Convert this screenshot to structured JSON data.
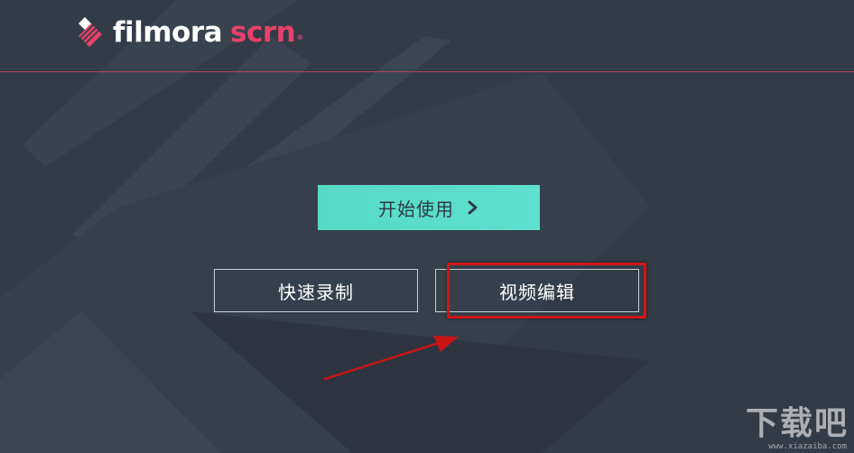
{
  "app": {
    "logo_word1": "filmora",
    "logo_word2": "scrn",
    "logo_reg": "®",
    "brand_color": "#e8426a"
  },
  "actions": {
    "start_label": "开始使用",
    "start_icon": "chevron-right-icon",
    "record_label": "快速录制",
    "edit_label": "视频编辑"
  },
  "annotation": {
    "highlight_color": "#d01515",
    "highlight_target": "视频编辑"
  },
  "watermark": {
    "big": "下载吧",
    "small": "www.xiazaiba.com"
  },
  "colors": {
    "background": "#333b47",
    "accent": "#5fe0d0",
    "divider": "#b5435f"
  }
}
